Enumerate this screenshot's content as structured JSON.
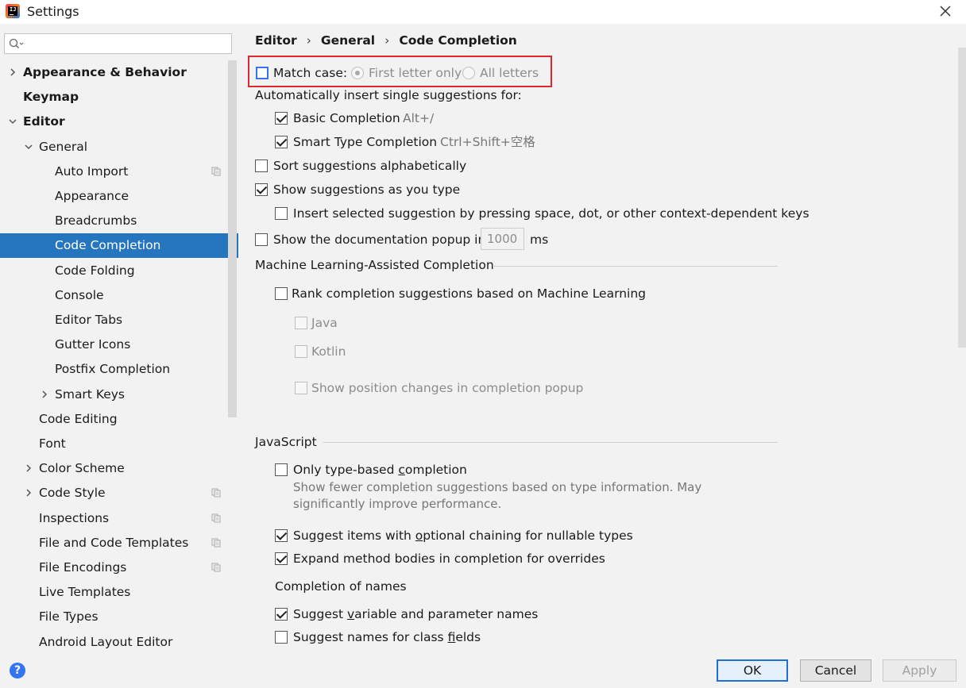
{
  "window": {
    "title": "Settings"
  },
  "search": {
    "placeholder": "",
    "value": ""
  },
  "sidebar": {
    "items": [
      {
        "label": "Appearance & Behavior",
        "bold": true,
        "arrow": "right",
        "indent": 0,
        "copy": false
      },
      {
        "label": "Keymap",
        "bold": true,
        "arrow": "",
        "indent": 0,
        "copy": false
      },
      {
        "label": "Editor",
        "bold": true,
        "arrow": "down",
        "indent": 0,
        "copy": false
      },
      {
        "label": "General",
        "bold": false,
        "arrow": "down",
        "indent": 1,
        "copy": false
      },
      {
        "label": "Auto Import",
        "bold": false,
        "arrow": "",
        "indent": 2,
        "copy": true
      },
      {
        "label": "Appearance",
        "bold": false,
        "arrow": "",
        "indent": 2,
        "copy": false
      },
      {
        "label": "Breadcrumbs",
        "bold": false,
        "arrow": "",
        "indent": 2,
        "copy": false
      },
      {
        "label": "Code Completion",
        "bold": false,
        "arrow": "",
        "indent": 2,
        "copy": false,
        "selected": true
      },
      {
        "label": "Code Folding",
        "bold": false,
        "arrow": "",
        "indent": 2,
        "copy": false
      },
      {
        "label": "Console",
        "bold": false,
        "arrow": "",
        "indent": 2,
        "copy": false
      },
      {
        "label": "Editor Tabs",
        "bold": false,
        "arrow": "",
        "indent": 2,
        "copy": false
      },
      {
        "label": "Gutter Icons",
        "bold": false,
        "arrow": "",
        "indent": 2,
        "copy": false
      },
      {
        "label": "Postfix Completion",
        "bold": false,
        "arrow": "",
        "indent": 2,
        "copy": false
      },
      {
        "label": "Smart Keys",
        "bold": false,
        "arrow": "right",
        "indent": 2,
        "copy": false
      },
      {
        "label": "Code Editing",
        "bold": false,
        "arrow": "",
        "indent": 1,
        "copy": false
      },
      {
        "label": "Font",
        "bold": false,
        "arrow": "",
        "indent": 1,
        "copy": false
      },
      {
        "label": "Color Scheme",
        "bold": false,
        "arrow": "right",
        "indent": 1,
        "copy": false
      },
      {
        "label": "Code Style",
        "bold": false,
        "arrow": "right",
        "indent": 1,
        "copy": true
      },
      {
        "label": "Inspections",
        "bold": false,
        "arrow": "",
        "indent": 1,
        "copy": true
      },
      {
        "label": "File and Code Templates",
        "bold": false,
        "arrow": "",
        "indent": 1,
        "copy": true
      },
      {
        "label": "File Encodings",
        "bold": false,
        "arrow": "",
        "indent": 1,
        "copy": true
      },
      {
        "label": "Live Templates",
        "bold": false,
        "arrow": "",
        "indent": 1,
        "copy": false
      },
      {
        "label": "File Types",
        "bold": false,
        "arrow": "",
        "indent": 1,
        "copy": false
      },
      {
        "label": "Android Layout Editor",
        "bold": false,
        "arrow": "",
        "indent": 1,
        "copy": false
      }
    ]
  },
  "breadcrumb": {
    "part1": "Editor",
    "part2": "General",
    "part3": "Code Completion",
    "separator": "›"
  },
  "settings": {
    "match_case": {
      "label": "Match case:",
      "checked": false
    },
    "first_letter_only": {
      "label": "First letter only",
      "checked": true
    },
    "all_letters": {
      "label": "All letters",
      "checked": false
    },
    "auto_insert_heading": "Automatically insert single suggestions for:",
    "basic_completion": {
      "label": "Basic Completion",
      "shortcut": "Alt+/",
      "checked": true
    },
    "smart_type_completion": {
      "label": "Smart Type Completion",
      "shortcut": "Ctrl+Shift+空格",
      "checked": true
    },
    "sort_alphabetically": {
      "label": "Sort suggestions alphabetically",
      "checked": false
    },
    "show_as_you_type": {
      "label": "Show suggestions as you type",
      "checked": true
    },
    "insert_selected": {
      "label": "Insert selected suggestion by pressing space, dot, or other context-dependent keys",
      "checked": false
    },
    "doc_popup": {
      "label": "Show the documentation popup in",
      "value": "1000",
      "unit": "ms",
      "checked": false
    },
    "ml_section": "Machine Learning-Assisted Completion",
    "ml_rank": {
      "label": "Rank completion suggestions based on Machine Learning",
      "checked": false
    },
    "ml_java": {
      "label": "Java",
      "checked": false
    },
    "ml_kotlin": {
      "label": "Kotlin",
      "checked": false
    },
    "ml_position": {
      "label": "Show position changes in completion popup",
      "checked": false
    },
    "js_section": "JavaScript",
    "only_type_based": {
      "label_pre": "Only type-based ",
      "label_u": "c",
      "label_post": "ompletion",
      "checked": false
    },
    "only_type_desc_1": "Show fewer completion suggestions based on type information. May",
    "only_type_desc_2": "significantly improve performance.",
    "optional_chaining": {
      "label_pre": "Suggest items with ",
      "label_u": "o",
      "label_post": "ptional chaining for nullable types",
      "checked": true
    },
    "expand_method": {
      "label": "Expand method bodies in completion for overrides",
      "checked": true
    },
    "completion_names_heading": "Completion of names",
    "suggest_variable": {
      "label_pre": "Suggest ",
      "label_u": "v",
      "label_post": "ariable and parameter names",
      "checked": true
    },
    "suggest_class_fields": {
      "label_pre": "Suggest names for class ",
      "label_u": "f",
      "label_post": "ields",
      "checked": false
    }
  },
  "footer": {
    "help": "?",
    "ok": "OK",
    "cancel": "Cancel",
    "apply": "Apply"
  }
}
